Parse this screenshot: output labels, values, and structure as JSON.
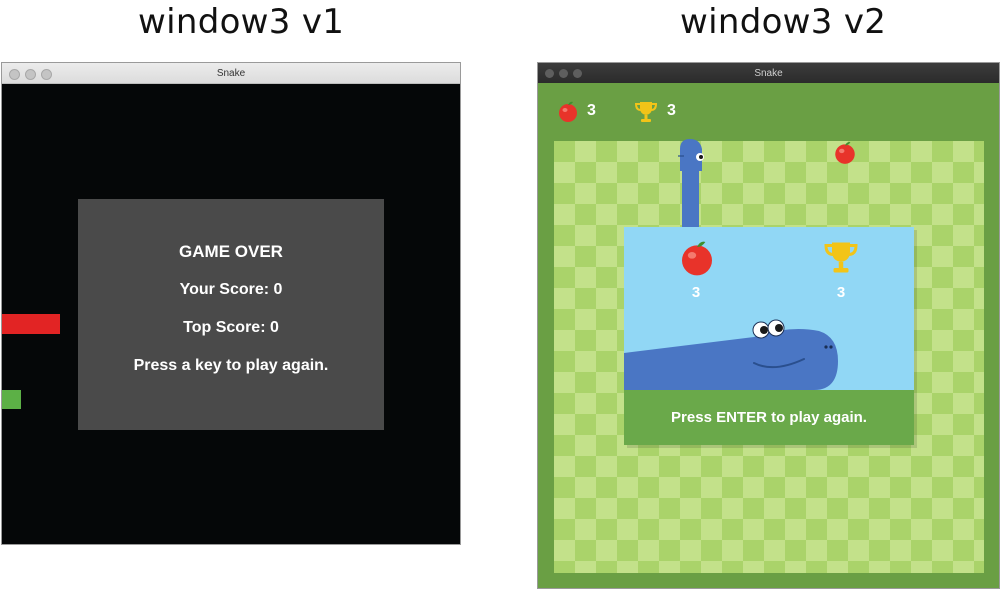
{
  "captions": {
    "left": "window3 v1",
    "right": "window3 v2"
  },
  "v1": {
    "window_title": "Snake",
    "game_over": {
      "heading": "GAME OVER",
      "your_score": "Your Score: 0",
      "top_score": "Top Score: 0",
      "prompt": "Press a key to play again."
    },
    "colors": {
      "background": "#050708",
      "panel": "#4a4a4a",
      "snake": "#e22424",
      "food": "#5cb046"
    }
  },
  "v2": {
    "window_title": "Snake",
    "hud": {
      "apples": "3",
      "trophies": "3"
    },
    "popup": {
      "apple_score": "3",
      "trophy_score": "3",
      "prompt": "Press ENTER to play again."
    },
    "icons": [
      "apple-icon",
      "trophy-icon",
      "snake-head",
      "snake-mascot"
    ],
    "colors": {
      "frame": "#6a9f44",
      "board_dark": "#aad36a",
      "board_light": "#c3e18a",
      "snake": "#4a76c4",
      "sky": "#91d7f5",
      "apple": "#e8332a",
      "trophy": "#f2c418"
    }
  }
}
